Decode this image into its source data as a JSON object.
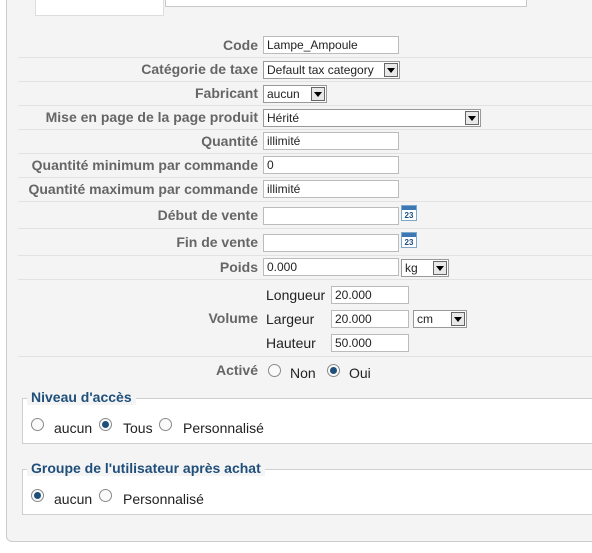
{
  "top": {
    "ellipsis": "..."
  },
  "form": {
    "code": {
      "label": "Code",
      "value": "Lampe_Ampoule"
    },
    "tax_category": {
      "label": "Catégorie de taxe",
      "value": "Default tax category"
    },
    "manufacturer": {
      "label": "Fabricant",
      "value": "aucun"
    },
    "layout": {
      "label": "Mise en page de la page produit",
      "value": "Hérité"
    },
    "quantity": {
      "label": "Quantité",
      "value": "illimité"
    },
    "min_qty": {
      "label": "Quantité minimum par commande",
      "value": "0"
    },
    "max_qty": {
      "label": "Quantité maximum par commande",
      "value": "illimité"
    },
    "sale_start": {
      "label": "Début de vente",
      "value": "",
      "calendar_text": "23"
    },
    "sale_end": {
      "label": "Fin de vente",
      "value": "",
      "calendar_text": "23"
    },
    "weight": {
      "label": "Poids",
      "value": "0.000",
      "unit": "kg"
    },
    "volume": {
      "label": "Volume",
      "length_label": "Longueur",
      "length": "20.000",
      "width_label": "Largeur",
      "width": "20.000",
      "height_label": "Hauteur",
      "height": "50.000",
      "unit": "cm"
    },
    "active": {
      "label": "Activé",
      "options": [
        "Non",
        "Oui"
      ],
      "selected": "Oui"
    }
  },
  "access": {
    "legend": "Niveau d'accès",
    "options": [
      "aucun",
      "Tous",
      "Personnalisé"
    ],
    "selected": "Tous"
  },
  "group": {
    "legend": "Groupe de l'utilisateur après achat",
    "options": [
      "aucun",
      "Personnalisé"
    ],
    "selected": "aucun"
  }
}
